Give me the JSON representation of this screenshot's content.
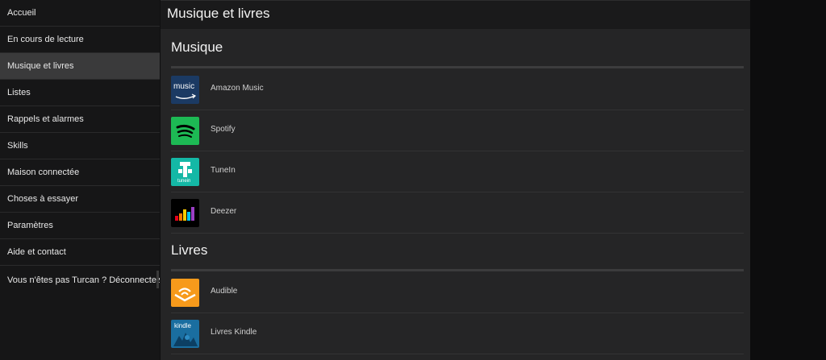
{
  "sidebar": {
    "items": [
      {
        "label": "Accueil"
      },
      {
        "label": "En cours de lecture"
      },
      {
        "label": "Musique et livres"
      },
      {
        "label": "Listes"
      },
      {
        "label": "Rappels et alarmes"
      },
      {
        "label": "Skills"
      },
      {
        "label": "Maison connectée"
      },
      {
        "label": "Choses à essayer"
      },
      {
        "label": "Paramètres"
      },
      {
        "label": "Aide et contact"
      },
      {
        "label": "Vous n'êtes pas Turcan ? Déconnectez-"
      }
    ],
    "active_index": 2
  },
  "header": {
    "title": "Musique et livres"
  },
  "sections": {
    "music": {
      "title": "Musique",
      "items": [
        {
          "label": "Amazon Music",
          "logo_text": "music",
          "icon": "amazon-music-icon"
        },
        {
          "label": "Spotify",
          "icon": "spotify-icon"
        },
        {
          "label": "TuneIn",
          "logo_text": "tunein",
          "icon": "tunein-icon"
        },
        {
          "label": "Deezer",
          "icon": "deezer-icon"
        }
      ]
    },
    "books": {
      "title": "Livres",
      "items": [
        {
          "label": "Audible",
          "icon": "audible-icon"
        },
        {
          "label": "Livres Kindle",
          "logo_text": "kindle",
          "icon": "kindle-icon"
        }
      ]
    }
  },
  "colors": {
    "active_item": "#3a3a3b",
    "spotify_green": "#1db954",
    "tunein_teal": "#14b8a6",
    "audible_orange": "#f79a1b",
    "amazon_blue": "#1b3a63",
    "kindle_blue": "#1a6ea0"
  }
}
